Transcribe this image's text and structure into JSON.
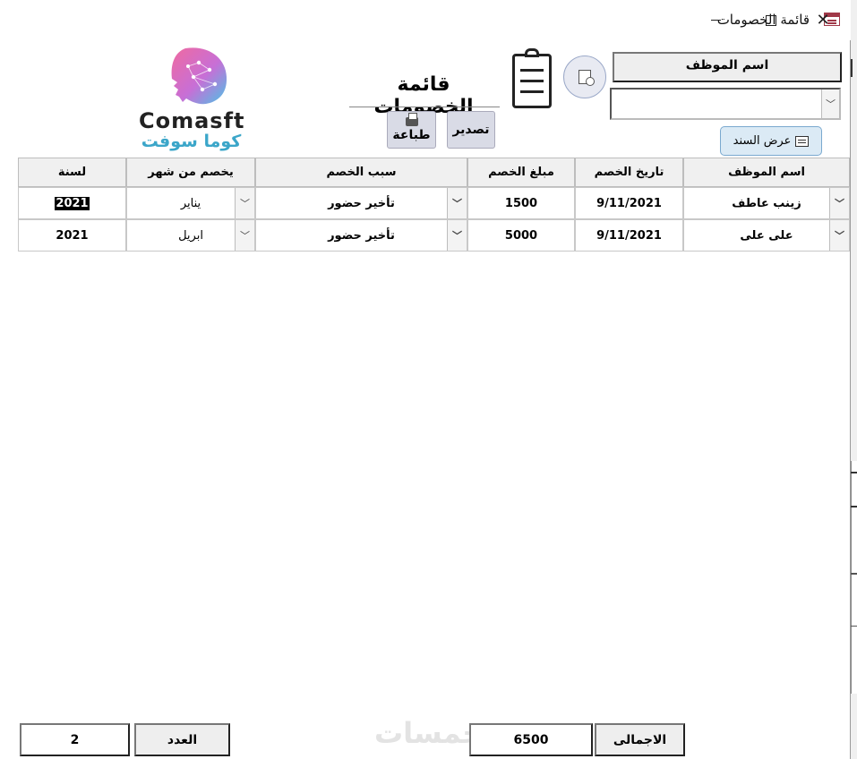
{
  "window": {
    "title": "قائمة الخصومات"
  },
  "header": {
    "employee_name_label": "اسم الموظف",
    "employee_combo_value": "",
    "form_title": "قائمة  الخصومات",
    "export_label": "تصدير",
    "print_label": "طباعة",
    "show_doc_label": "عرض السند"
  },
  "logo": {
    "text_en": "Comasft",
    "text_ar": "كوما سوفت"
  },
  "table": {
    "headers": {
      "employee": "اسم الموظف",
      "date": "تاريخ الخصم",
      "amount": "مبلغ الخصم",
      "reason": "سبب الخصم",
      "month": "يخصم من شهر",
      "year": "لسنة"
    },
    "rows": [
      {
        "employee": "زينب عاطف",
        "date": "9/11/2021",
        "amount": "1500",
        "reason": "تأخير حضور",
        "month": "يناير",
        "year": "2021"
      },
      {
        "employee": "على على",
        "date": "9/11/2021",
        "amount": "5000",
        "reason": "تأخير حضور",
        "month": "ابريل",
        "year": "2021"
      }
    ]
  },
  "footer": {
    "total_label": "الاجمالى",
    "total_value": "6500",
    "count_label": "العدد",
    "count_value": "2"
  },
  "watermark": "خمسات",
  "colors": {
    "logo_pink": "#e0507a",
    "logo_blue": "#3ba6c9",
    "button_bg": "#d9dbe6",
    "show_doc_bg": "#dbeaf5"
  }
}
